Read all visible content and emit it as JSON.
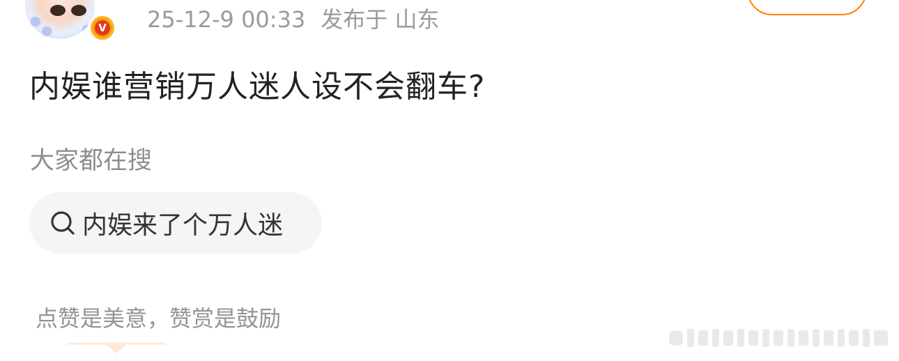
{
  "header": {
    "timestamp": "25-12-9 00:33",
    "location": "发布于 山东",
    "avatar": "avatar-illustration",
    "badge_icon": "verified-v-icon",
    "badge_letter": "V",
    "accent_color": "#ff8200"
  },
  "post": {
    "text": "内娱谁营销万人迷人设不会翻车?"
  },
  "trending": {
    "title": "大家都在搜",
    "search_icon": "search-icon",
    "query": "内娱来了个万人迷"
  },
  "reward": {
    "text": "点赞是美意，赞赏是鼓励",
    "arrow_icon": "triangle-down-icon"
  },
  "watermark": {
    "icon": "blurred-watermark"
  }
}
